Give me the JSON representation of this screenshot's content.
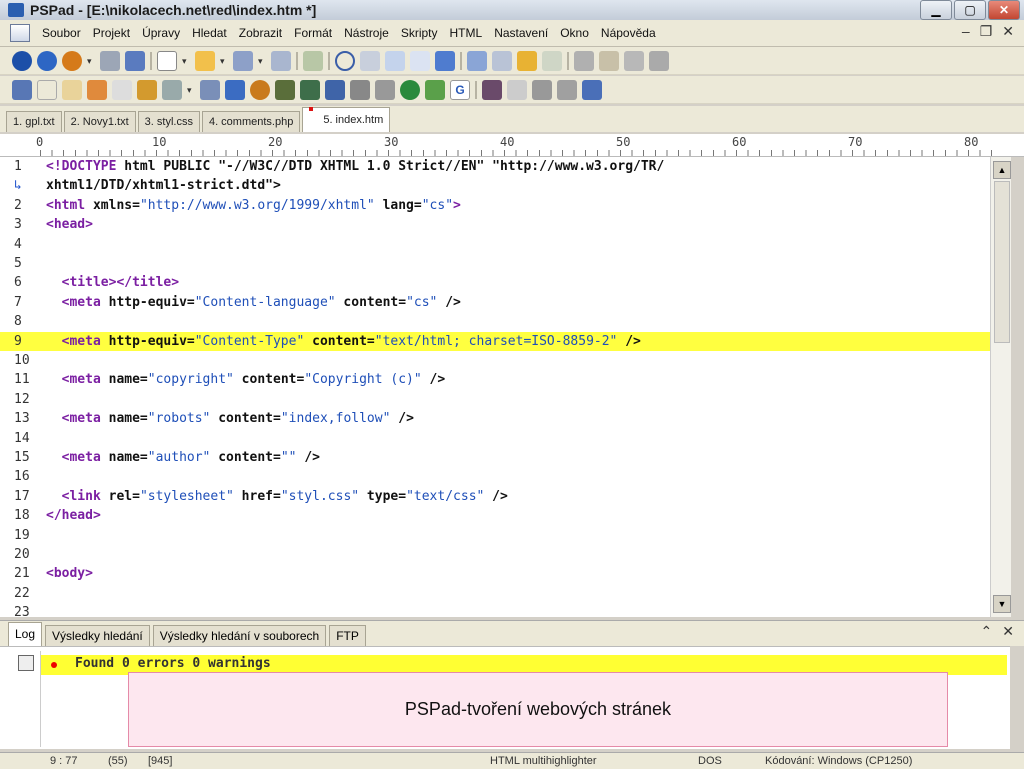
{
  "window": {
    "title": "PSPad - [E:\\nikolacech.net\\red\\index.htm *]"
  },
  "menu": [
    "Soubor",
    "Projekt",
    "Úpravy",
    "Hledat",
    "Zobrazit",
    "Formát",
    "Nástroje",
    "Skripty",
    "HTML",
    "Nastavení",
    "Okno",
    "Nápověda"
  ],
  "tabs": [
    "1. gpl.txt",
    "2. Novy1.txt",
    "3. styl.css",
    "4. comments.php",
    "5. index.htm"
  ],
  "ruler": [
    "0",
    "10",
    "20",
    "30",
    "40",
    "50",
    "60",
    "70",
    "80"
  ],
  "editor": {
    "lines": [
      {
        "n": "1",
        "parts": [
          [
            "tag",
            "<!DOCTYPE"
          ],
          [
            "attr",
            " html PUBLIC "
          ],
          [
            "attr",
            "\"-//W3C//DTD XHTML 1.0 Strict//EN\""
          ],
          [
            "attr",
            " \"http://www.w3.org/TR/"
          ]
        ]
      },
      {
        "n": "",
        "wrap": true,
        "parts": [
          [
            "attr",
            "xhtml1/DTD/xhtml1-strict.dtd\">"
          ]
        ]
      },
      {
        "n": "2",
        "parts": [
          [
            "tag",
            "<html"
          ],
          [
            "attr",
            " xmlns="
          ],
          [
            "str",
            "\"http://www.w3.org/1999/xhtml\""
          ],
          [
            "attr",
            " lang="
          ],
          [
            "str",
            "\"cs\""
          ],
          [
            "tag",
            ">"
          ]
        ]
      },
      {
        "n": "3",
        "parts": [
          [
            "tag",
            "<head>"
          ]
        ]
      },
      {
        "n": "4",
        "parts": []
      },
      {
        "n": "5",
        "parts": []
      },
      {
        "n": "6",
        "parts": [
          [
            "tag",
            "  <title></title>"
          ]
        ]
      },
      {
        "n": "7",
        "parts": [
          [
            "tag",
            "  <meta"
          ],
          [
            "attr",
            " http-equiv="
          ],
          [
            "str",
            "\"Content-language\""
          ],
          [
            "attr",
            " content="
          ],
          [
            "str",
            "\"cs\""
          ],
          [
            "attr",
            " />"
          ]
        ]
      },
      {
        "n": "8",
        "parts": []
      },
      {
        "n": "9",
        "hl": true,
        "parts": [
          [
            "tag",
            "  <meta"
          ],
          [
            "attr",
            " http-equiv="
          ],
          [
            "str",
            "\"Content-Type\""
          ],
          [
            "attr",
            " content="
          ],
          [
            "str",
            "\"text/html; charset=ISO-8859-2\""
          ],
          [
            "attr",
            " />"
          ]
        ]
      },
      {
        "n": "10",
        "parts": []
      },
      {
        "n": "11",
        "parts": [
          [
            "tag",
            "  <meta"
          ],
          [
            "attr",
            " name="
          ],
          [
            "str",
            "\"copyright\""
          ],
          [
            "attr",
            " content="
          ],
          [
            "str",
            "\"Copyright (c)\""
          ],
          [
            "attr",
            " />"
          ]
        ]
      },
      {
        "n": "12",
        "parts": []
      },
      {
        "n": "13",
        "parts": [
          [
            "tag",
            "  <meta"
          ],
          [
            "attr",
            " name="
          ],
          [
            "str",
            "\"robots\""
          ],
          [
            "attr",
            " content="
          ],
          [
            "str",
            "\"index,follow\""
          ],
          [
            "attr",
            " />"
          ]
        ]
      },
      {
        "n": "14",
        "parts": []
      },
      {
        "n": "15",
        "parts": [
          [
            "tag",
            "  <meta"
          ],
          [
            "attr",
            " name="
          ],
          [
            "str",
            "\"author\""
          ],
          [
            "attr",
            " content="
          ],
          [
            "str",
            "\"\""
          ],
          [
            "attr",
            " />"
          ]
        ]
      },
      {
        "n": "16",
        "parts": []
      },
      {
        "n": "17",
        "parts": [
          [
            "tag",
            "  <link"
          ],
          [
            "attr",
            " rel="
          ],
          [
            "str",
            "\"stylesheet\""
          ],
          [
            "attr",
            " href="
          ],
          [
            "str",
            "\"styl.css\""
          ],
          [
            "attr",
            " type="
          ],
          [
            "str",
            "\"text/css\""
          ],
          [
            "attr",
            " />"
          ]
        ]
      },
      {
        "n": "18",
        "parts": [
          [
            "tag",
            "</head>"
          ]
        ]
      },
      {
        "n": "19",
        "parts": []
      },
      {
        "n": "20",
        "parts": []
      },
      {
        "n": "21",
        "parts": [
          [
            "tag",
            "<body>"
          ]
        ]
      },
      {
        "n": "22",
        "parts": []
      },
      {
        "n": "23",
        "parts": []
      }
    ]
  },
  "log": {
    "tabs": [
      "Log",
      "Výsledky hledání",
      "Výsledky hledání v souborech",
      "FTP"
    ],
    "message": "Found 0 errors 0 warnings"
  },
  "caption": "PSPad-tvoření webových stránek",
  "status": {
    "pos": "9 : 77",
    "codes": "(55)",
    "size": "[945]",
    "highlighter": "HTML multihighlighter",
    "eol": "DOS",
    "encoding": "Kódování: Windows (CP1250)"
  },
  "colors": {
    "highlight": "#ffff40",
    "tag": "#7b1fa2",
    "string": "#1f4fb8",
    "caption_bg": "#fde7ef"
  }
}
